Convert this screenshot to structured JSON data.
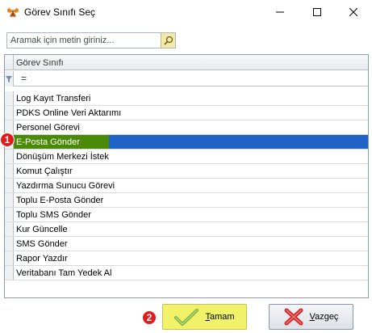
{
  "window": {
    "title": "Görev Sınıfı Seç"
  },
  "search": {
    "placeholder": "Aramak için metin giriniz..."
  },
  "grid": {
    "column_header": "Görev Sınıfı",
    "filter_operator": "=",
    "rows": [
      "Log Kayıt Transferi",
      "PDKS Online Veri Aktarımı",
      "Personel Görevi",
      "E-Posta Gönder",
      "Dönüşüm Merkezi İstek",
      "Komut Çalıştır",
      "Yazdırma Sunucu Görevi",
      "Toplu E-Posta Gönder",
      "Toplu SMS Gönder",
      "Kur Güncelle",
      "SMS Gönder",
      "Rapor Yazdır",
      "Veritabanı Tam Yedek Al"
    ],
    "selected_index": 3
  },
  "badges": {
    "one": "1",
    "two": "2"
  },
  "buttons": {
    "ok": {
      "accel": "T",
      "rest": "amam"
    },
    "cancel": {
      "accel": "V",
      "rest": "azgeç"
    }
  },
  "colors": {
    "selection": "#1f63c7",
    "selection_highlight": "#4a8a06",
    "ok_button": "#f2f26a",
    "badge": "#e21b1b"
  }
}
